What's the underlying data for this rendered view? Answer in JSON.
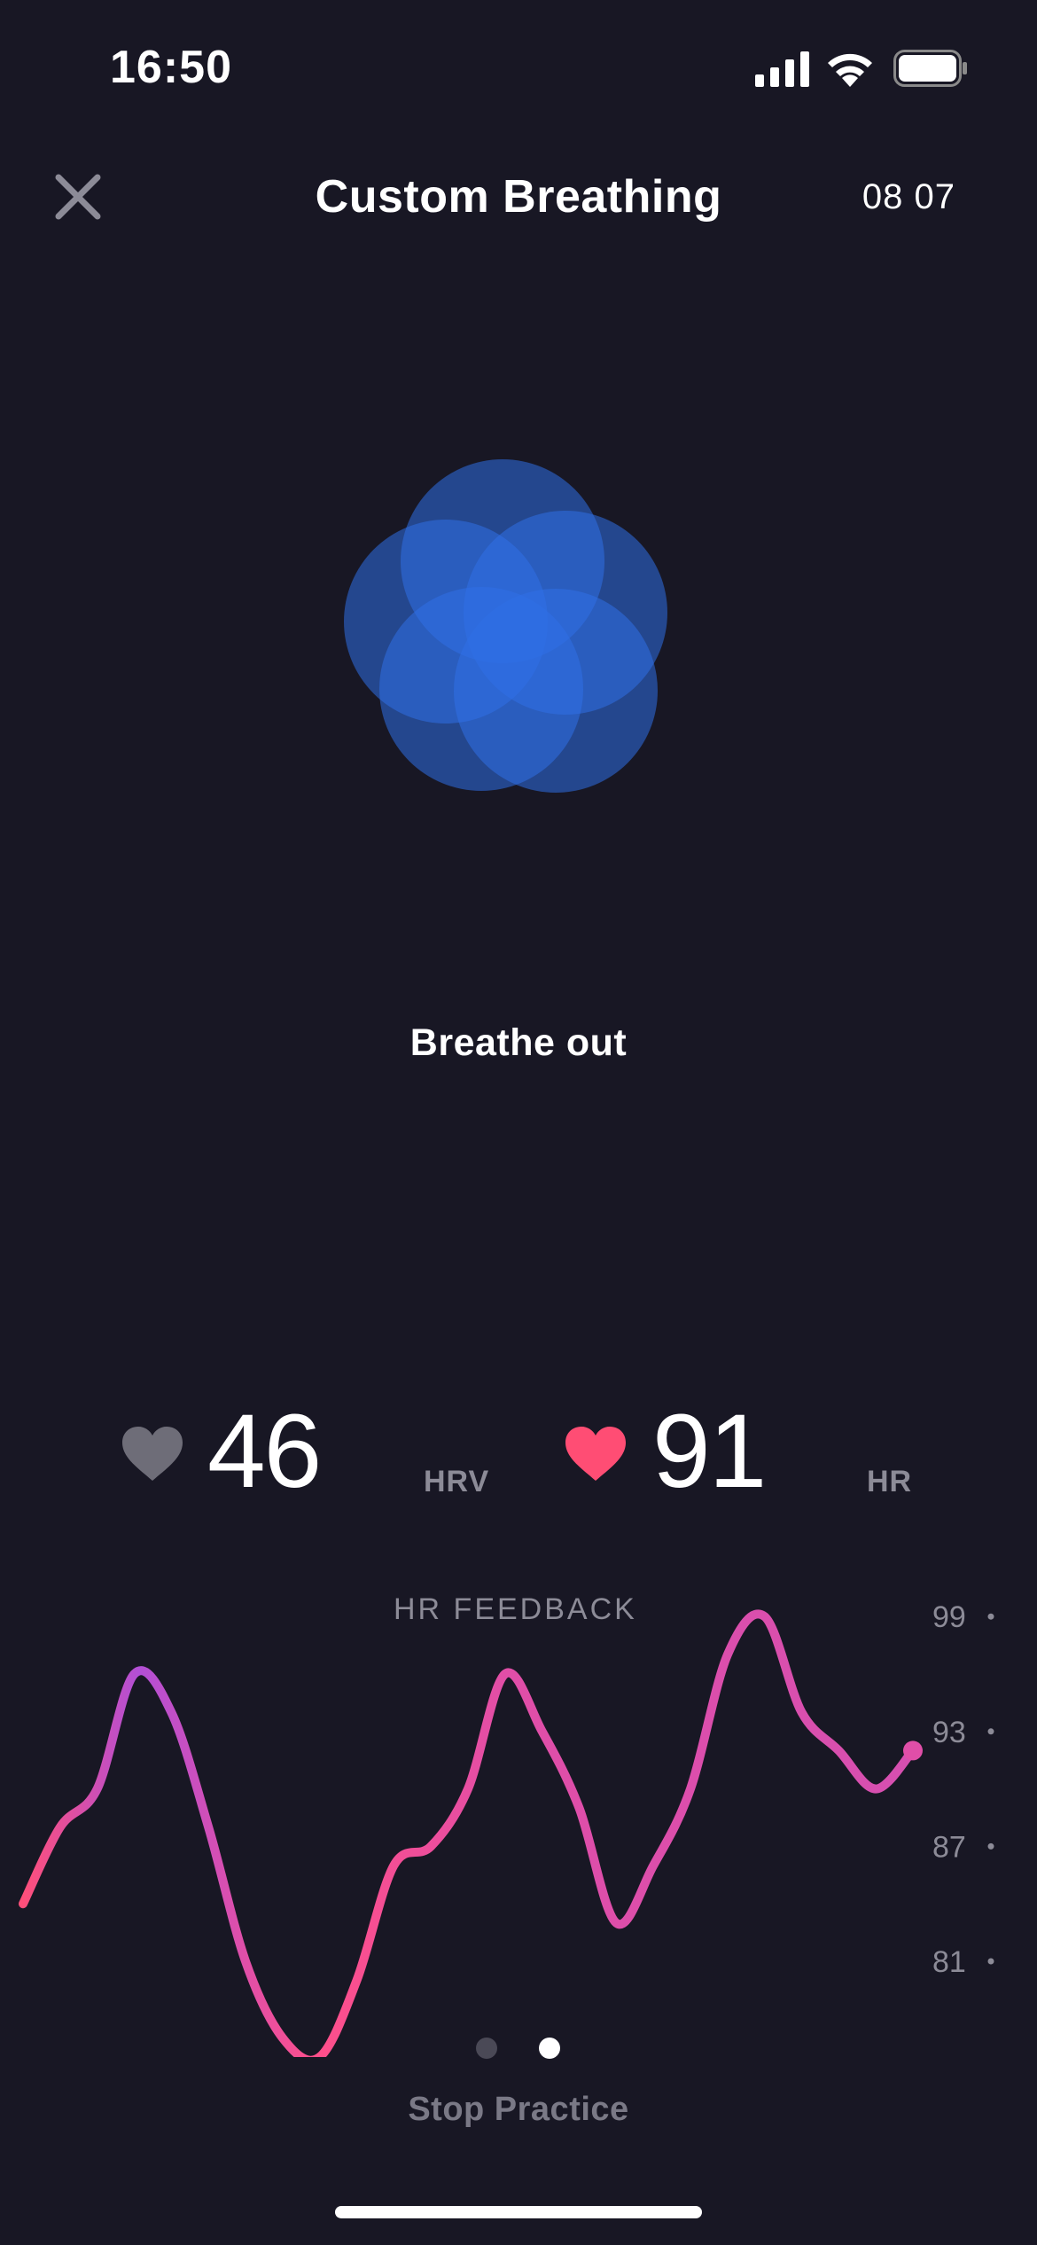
{
  "status_bar": {
    "time": "16:50",
    "icons": [
      "signal-icon",
      "wifi-icon",
      "battery-icon"
    ]
  },
  "nav": {
    "close_icon": "close-icon",
    "title": "Custom Breathing",
    "timer": "08 07"
  },
  "breathing": {
    "instruction": "Breathe out",
    "flower_color": "#2f6fe6"
  },
  "metrics": {
    "hrv": {
      "value": "46",
      "label": "HRV",
      "icon": "heart-icon",
      "color": "#6e6d78"
    },
    "hr": {
      "value": "91",
      "label": "HR",
      "icon": "heart-icon",
      "color": "#ff4d74"
    }
  },
  "feedback": {
    "title": "HR FEEDBACK"
  },
  "chart_data": {
    "type": "line",
    "title": "HR FEEDBACK",
    "y_ticks": [
      "99",
      "93",
      "87",
      "81"
    ],
    "ylim": [
      76,
      101
    ],
    "series": [
      {
        "values": [
          84,
          88,
          90,
          96,
          94,
          88,
          81,
          77,
          76,
          80,
          86,
          87,
          90,
          96,
          93,
          89,
          83,
          86,
          90,
          97,
          99,
          94,
          92,
          90,
          92
        ]
      }
    ],
    "gradient_colors": [
      "#ff4f7a",
      "#b24fd6",
      "#e04ea8"
    ]
  },
  "pager": {
    "pages": 2,
    "current": 2
  },
  "actions": {
    "stop_label": "Stop Practice"
  }
}
